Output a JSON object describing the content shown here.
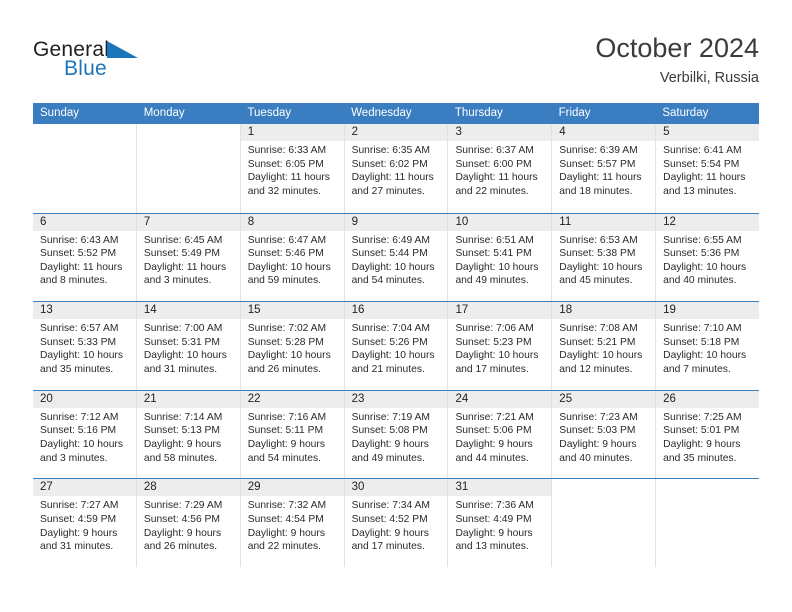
{
  "brand": {
    "name_top": "General",
    "name_bottom": "Blue",
    "triangle_color": "#1b75bb"
  },
  "header": {
    "title": "October 2024",
    "subtitle": "Verbilki, Russia"
  },
  "theme": {
    "header_blue": "#3a7dc0",
    "daynum_band": "#ededed",
    "cell_border": "#e2e2e2",
    "text": "#222222"
  },
  "calendar": {
    "weekday_headers": [
      "Sunday",
      "Monday",
      "Tuesday",
      "Wednesday",
      "Thursday",
      "Friday",
      "Saturday"
    ],
    "weeks": [
      [
        {
          "day": "",
          "sunrise": "",
          "sunset": "",
          "daylight": "",
          "empty": true
        },
        {
          "day": "",
          "sunrise": "",
          "sunset": "",
          "daylight": "",
          "empty": true
        },
        {
          "day": "1",
          "sunrise": "Sunrise: 6:33 AM",
          "sunset": "Sunset: 6:05 PM",
          "daylight": "Daylight: 11 hours and 32 minutes."
        },
        {
          "day": "2",
          "sunrise": "Sunrise: 6:35 AM",
          "sunset": "Sunset: 6:02 PM",
          "daylight": "Daylight: 11 hours and 27 minutes."
        },
        {
          "day": "3",
          "sunrise": "Sunrise: 6:37 AM",
          "sunset": "Sunset: 6:00 PM",
          "daylight": "Daylight: 11 hours and 22 minutes."
        },
        {
          "day": "4",
          "sunrise": "Sunrise: 6:39 AM",
          "sunset": "Sunset: 5:57 PM",
          "daylight": "Daylight: 11 hours and 18 minutes."
        },
        {
          "day": "5",
          "sunrise": "Sunrise: 6:41 AM",
          "sunset": "Sunset: 5:54 PM",
          "daylight": "Daylight: 11 hours and 13 minutes."
        }
      ],
      [
        {
          "day": "6",
          "sunrise": "Sunrise: 6:43 AM",
          "sunset": "Sunset: 5:52 PM",
          "daylight": "Daylight: 11 hours and 8 minutes."
        },
        {
          "day": "7",
          "sunrise": "Sunrise: 6:45 AM",
          "sunset": "Sunset: 5:49 PM",
          "daylight": "Daylight: 11 hours and 3 minutes."
        },
        {
          "day": "8",
          "sunrise": "Sunrise: 6:47 AM",
          "sunset": "Sunset: 5:46 PM",
          "daylight": "Daylight: 10 hours and 59 minutes."
        },
        {
          "day": "9",
          "sunrise": "Sunrise: 6:49 AM",
          "sunset": "Sunset: 5:44 PM",
          "daylight": "Daylight: 10 hours and 54 minutes."
        },
        {
          "day": "10",
          "sunrise": "Sunrise: 6:51 AM",
          "sunset": "Sunset: 5:41 PM",
          "daylight": "Daylight: 10 hours and 49 minutes."
        },
        {
          "day": "11",
          "sunrise": "Sunrise: 6:53 AM",
          "sunset": "Sunset: 5:38 PM",
          "daylight": "Daylight: 10 hours and 45 minutes."
        },
        {
          "day": "12",
          "sunrise": "Sunrise: 6:55 AM",
          "sunset": "Sunset: 5:36 PM",
          "daylight": "Daylight: 10 hours and 40 minutes."
        }
      ],
      [
        {
          "day": "13",
          "sunrise": "Sunrise: 6:57 AM",
          "sunset": "Sunset: 5:33 PM",
          "daylight": "Daylight: 10 hours and 35 minutes."
        },
        {
          "day": "14",
          "sunrise": "Sunrise: 7:00 AM",
          "sunset": "Sunset: 5:31 PM",
          "daylight": "Daylight: 10 hours and 31 minutes."
        },
        {
          "day": "15",
          "sunrise": "Sunrise: 7:02 AM",
          "sunset": "Sunset: 5:28 PM",
          "daylight": "Daylight: 10 hours and 26 minutes."
        },
        {
          "day": "16",
          "sunrise": "Sunrise: 7:04 AM",
          "sunset": "Sunset: 5:26 PM",
          "daylight": "Daylight: 10 hours and 21 minutes."
        },
        {
          "day": "17",
          "sunrise": "Sunrise: 7:06 AM",
          "sunset": "Sunset: 5:23 PM",
          "daylight": "Daylight: 10 hours and 17 minutes."
        },
        {
          "day": "18",
          "sunrise": "Sunrise: 7:08 AM",
          "sunset": "Sunset: 5:21 PM",
          "daylight": "Daylight: 10 hours and 12 minutes."
        },
        {
          "day": "19",
          "sunrise": "Sunrise: 7:10 AM",
          "sunset": "Sunset: 5:18 PM",
          "daylight": "Daylight: 10 hours and 7 minutes."
        }
      ],
      [
        {
          "day": "20",
          "sunrise": "Sunrise: 7:12 AM",
          "sunset": "Sunset: 5:16 PM",
          "daylight": "Daylight: 10 hours and 3 minutes."
        },
        {
          "day": "21",
          "sunrise": "Sunrise: 7:14 AM",
          "sunset": "Sunset: 5:13 PM",
          "daylight": "Daylight: 9 hours and 58 minutes."
        },
        {
          "day": "22",
          "sunrise": "Sunrise: 7:16 AM",
          "sunset": "Sunset: 5:11 PM",
          "daylight": "Daylight: 9 hours and 54 minutes."
        },
        {
          "day": "23",
          "sunrise": "Sunrise: 7:19 AM",
          "sunset": "Sunset: 5:08 PM",
          "daylight": "Daylight: 9 hours and 49 minutes."
        },
        {
          "day": "24",
          "sunrise": "Sunrise: 7:21 AM",
          "sunset": "Sunset: 5:06 PM",
          "daylight": "Daylight: 9 hours and 44 minutes."
        },
        {
          "day": "25",
          "sunrise": "Sunrise: 7:23 AM",
          "sunset": "Sunset: 5:03 PM",
          "daylight": "Daylight: 9 hours and 40 minutes."
        },
        {
          "day": "26",
          "sunrise": "Sunrise: 7:25 AM",
          "sunset": "Sunset: 5:01 PM",
          "daylight": "Daylight: 9 hours and 35 minutes."
        }
      ],
      [
        {
          "day": "27",
          "sunrise": "Sunrise: 7:27 AM",
          "sunset": "Sunset: 4:59 PM",
          "daylight": "Daylight: 9 hours and 31 minutes."
        },
        {
          "day": "28",
          "sunrise": "Sunrise: 7:29 AM",
          "sunset": "Sunset: 4:56 PM",
          "daylight": "Daylight: 9 hours and 26 minutes."
        },
        {
          "day": "29",
          "sunrise": "Sunrise: 7:32 AM",
          "sunset": "Sunset: 4:54 PM",
          "daylight": "Daylight: 9 hours and 22 minutes."
        },
        {
          "day": "30",
          "sunrise": "Sunrise: 7:34 AM",
          "sunset": "Sunset: 4:52 PM",
          "daylight": "Daylight: 9 hours and 17 minutes."
        },
        {
          "day": "31",
          "sunrise": "Sunrise: 7:36 AM",
          "sunset": "Sunset: 4:49 PM",
          "daylight": "Daylight: 9 hours and 13 minutes."
        },
        {
          "day": "",
          "sunrise": "",
          "sunset": "",
          "daylight": "",
          "empty": true
        },
        {
          "day": "",
          "sunrise": "",
          "sunset": "",
          "daylight": "",
          "empty": true
        }
      ]
    ]
  }
}
